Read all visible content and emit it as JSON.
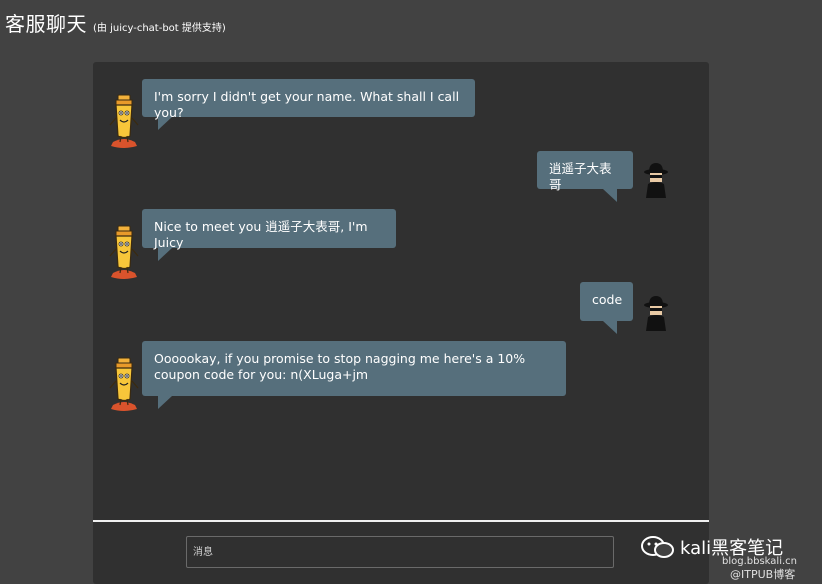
{
  "header": {
    "title": "客服聊天",
    "subtitle": "(由 juicy-chat-bot 提供支持)"
  },
  "messages": [
    {
      "sender": "bot",
      "text": "I'm sorry I didn't get your name. What shall I call you?"
    },
    {
      "sender": "user",
      "text": "逍遥子大表哥"
    },
    {
      "sender": "bot",
      "text": "Nice to meet you 逍遥子大表哥, I'm Juicy"
    },
    {
      "sender": "user",
      "text": "code"
    },
    {
      "sender": "bot",
      "text": "Oooookay, if you promise to stop nagging me here's a 10% coupon code for you: n(XLuga+jm"
    }
  ],
  "composer": {
    "placeholder": "消息"
  },
  "watermark": {
    "main": "kali黑客笔记",
    "sub1": "blog.bbskali.cn",
    "sub2": "@ITPUB博客"
  },
  "colors": {
    "page_bg": "#424242",
    "card_bg": "#303030",
    "bubble_bg": "#566f7c",
    "divider": "#f0f0f0"
  }
}
